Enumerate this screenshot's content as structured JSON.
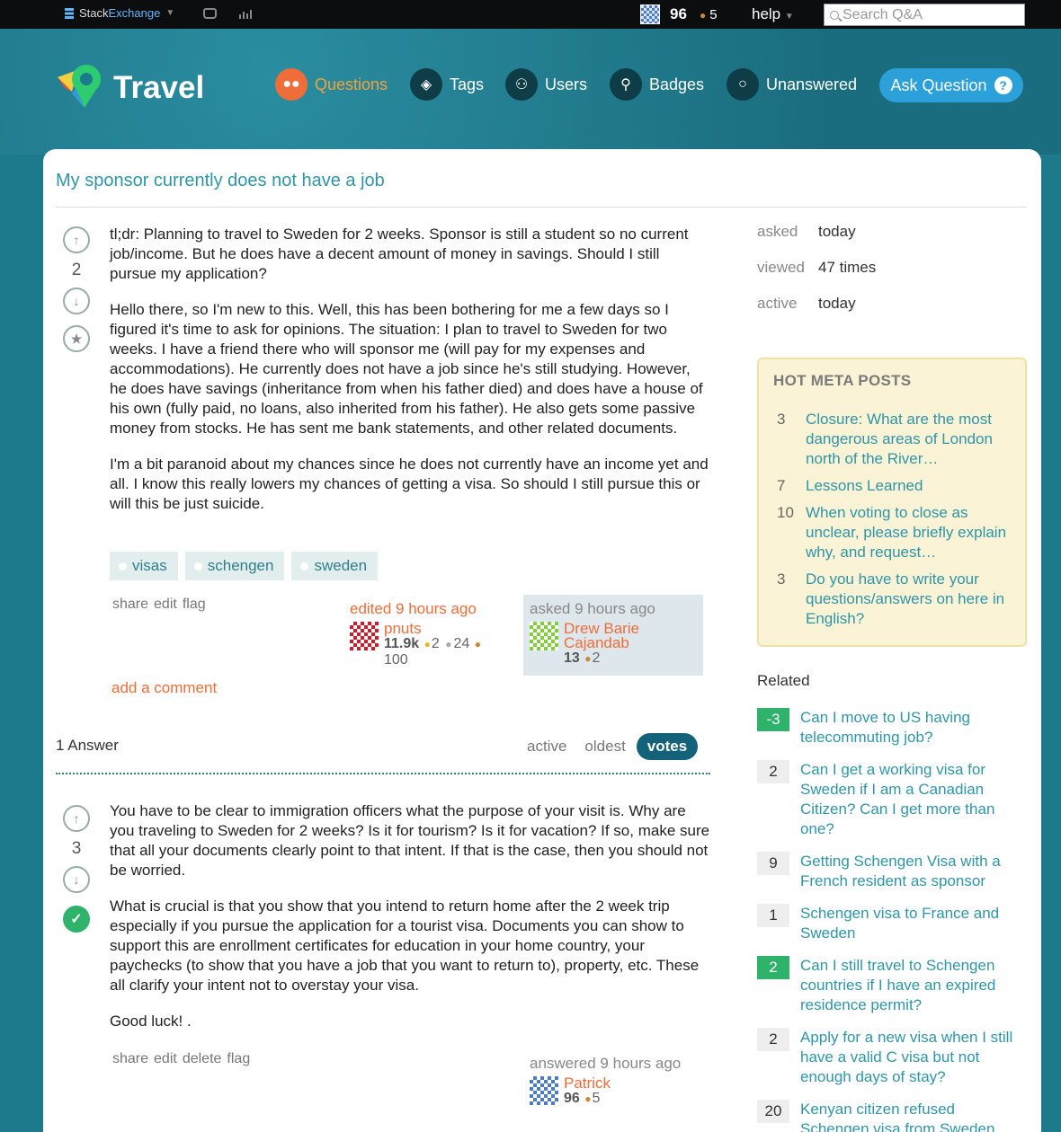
{
  "topbar": {
    "network_label_1": "Stack",
    "network_label_2": "Exchange",
    "reputation": "96",
    "bronze_badges": "5",
    "help_label": "help",
    "search_placeholder": "Search Q&A"
  },
  "header": {
    "site_name": "Travel",
    "nav": [
      {
        "label": "Questions",
        "active": true
      },
      {
        "label": "Tags"
      },
      {
        "label": "Users"
      },
      {
        "label": "Badges"
      },
      {
        "label": "Unanswered"
      }
    ],
    "ask_label": "Ask Question"
  },
  "colors": {
    "accent": "#ef6d39",
    "link": "#2f95a8",
    "accepted": "#2fb36b",
    "header_bg": "#1d7a8c"
  },
  "question": {
    "title": "My sponsor currently does not have a job",
    "votes": "2",
    "paragraphs": [
      "tl;dr: Planning to travel to Sweden for 2 weeks. Sponsor is still a student so no current job/income. But he does have a decent amount of money in savings. Should I still pursue my application?",
      "Hello there, so I'm new to this. Well, this has been bothering for me a few days so I figured it's time to ask for opinions. The situation: I plan to travel to Sweden for two weeks. I have a friend there who will sponsor me (will pay for my expenses and accommodations). He currently does not have a job since he's still studying. However, he does have savings (inheritance from when his father died) and does have a house of his own (fully paid, no loans, also inherited from his father). He also gets some passive money from stocks. He has sent me bank statements, and other related documents.",
      "I'm a bit paranoid about my chances since he does not currently have an income yet and all. I know this really lowers my chances of getting a visa. So should I still pursue this or will this be just suicide."
    ],
    "tags": [
      "visas",
      "schengen",
      "sweden"
    ],
    "menu": [
      "share",
      "edit",
      "flag"
    ],
    "edited": {
      "when": "edited 9 hours ago",
      "user": "pnuts",
      "rep": "11.9k",
      "gold": "2",
      "silver": "24",
      "bronze": "100"
    },
    "asked": {
      "when": "asked 9 hours ago",
      "user_line1": "Drew Barie",
      "user_line2": "Cajandab",
      "rep": "13",
      "bronze": "2"
    },
    "add_comment": "add a comment"
  },
  "answers": {
    "count_label": "1 Answer",
    "sort_tabs": [
      "active",
      "oldest",
      "votes"
    ],
    "items": [
      {
        "votes": "3",
        "paragraphs": [
          "You have to be clear to immigration officers what the purpose of your visit is. Why are you traveling to Sweden for 2 weeks? Is it for tourism? Is it for vacation? If so, make sure that all your documents clearly point to that intent. If that is the case, then you should not be worried.",
          "What is crucial is that you show that you intend to return home after the 2 week trip especially if you pursue the application for a tourist visa. Documents you can show to support this are enrollment certificates for education in your home country, your paychecks (to show that you have a job that you want to return to), property, etc. These all clarify your intent not to overstay your visa.",
          "Good luck! ."
        ],
        "menu": [
          "share",
          "edit",
          "delete",
          "flag"
        ],
        "answered": {
          "when": "answered 9 hours ago",
          "user": "Patrick",
          "rep": "96",
          "bronze": "5"
        }
      }
    ]
  },
  "sidebar": {
    "meta": [
      {
        "label": "asked",
        "value": "today"
      },
      {
        "label": "viewed",
        "value": "47 times"
      },
      {
        "label": "active",
        "value": "today"
      }
    ],
    "hot_meta_title": "HOT META POSTS",
    "hot_meta": [
      {
        "num": "3",
        "title": "Closure: What are the most dangerous areas of London north of the River…"
      },
      {
        "num": "7",
        "title": "Lessons Learned"
      },
      {
        "num": "10",
        "title": "When voting to close as unclear, please briefly explain why, and request…"
      },
      {
        "num": "3",
        "title": "Do you have to write your questions/answers on here in English?"
      }
    ],
    "related_title": "Related",
    "related": [
      {
        "score": "-3",
        "accepted": true,
        "title": "Can I move to US having telecommuting job?"
      },
      {
        "score": "2",
        "accepted": false,
        "title": "Can I get a working visa for Sweden if I am a Canadian Citizen? Can I get more than one?"
      },
      {
        "score": "9",
        "accepted": false,
        "title": "Getting Schengen Visa with a French resident as sponsor"
      },
      {
        "score": "1",
        "accepted": false,
        "title": "Schengen visa to France and Sweden"
      },
      {
        "score": "2",
        "accepted": true,
        "title": "Can I still travel to Schengen countries if I have an expired residence permit?"
      },
      {
        "score": "2",
        "accepted": false,
        "title": "Apply for a new visa when I still have a valid C visa but not enough days of stay?"
      },
      {
        "score": "20",
        "accepted": false,
        "title": "Kenyan citizen refused Schengen visa from Sweden"
      }
    ]
  }
}
